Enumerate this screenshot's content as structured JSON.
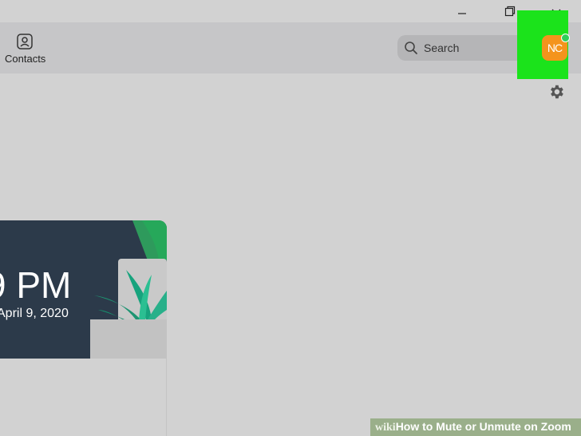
{
  "window": {
    "minimize_icon": "minimize-icon",
    "restore_icon": "restore-icon",
    "chevron_icon": "chevron-down-icon"
  },
  "toolbar": {
    "contacts_label": "Contacts",
    "search_placeholder": "Search",
    "avatar_initials": "NC"
  },
  "card": {
    "time": "9 PM",
    "date": "April 9, 2020"
  },
  "watermark": {
    "prefix": "wiki",
    "text": "How to Mute or Unmute on Zoom"
  },
  "colors": {
    "highlight": "#1be31b",
    "avatar": "#f4941c",
    "status": "#2fcf5a",
    "card_background": "#2c3a4a"
  }
}
